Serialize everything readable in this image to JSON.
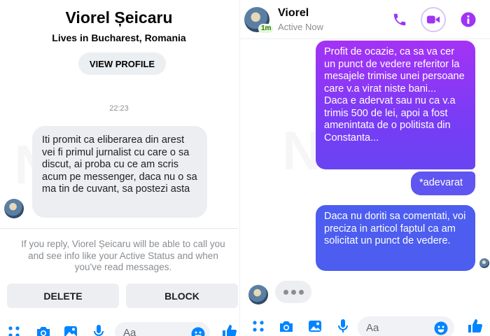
{
  "left": {
    "profile": {
      "name": "Viorel Șeicaru",
      "location": "Lives in Bucharest, Romania",
      "view_profile": "VIEW PROFILE"
    },
    "timestamp": "22:23",
    "message": "Iti promit ca eliberarea din arest vei fi primul jurnalist cu care o sa discut, ai proba cu ce am scris acum pe messenger, daca nu o sa ma tin de cuvant, sa postezi asta",
    "notice": "If you reply, Viorel Șeicaru will be able to call you and see info like your Active Status and when you've read messages.",
    "actions": {
      "delete": "DELETE",
      "block": "BLOCK"
    },
    "composer": {
      "placeholder": "Aa"
    }
  },
  "right": {
    "header": {
      "name": "Viorel",
      "status": "Active Now",
      "badge": "1m",
      "icons": [
        "phone-icon",
        "video-call-icon",
        "info-icon"
      ]
    },
    "messages": [
      {
        "sender": "me",
        "text": "Profit de ocazie, ca sa va cer un punct de vedere referitor la mesajele trimise unei persoane care v.a virat niste bani...\nDaca e adervat sau nu ca v.a trimis 500 de lei, apoi a fost amenintata de o politista din Constanta..."
      },
      {
        "sender": "me",
        "text": "*adevarat"
      },
      {
        "sender": "me",
        "text": "Daca nu doriti sa comentati, voi preciza in articol faptul ca am solicitat un punct de vedere."
      }
    ],
    "composer": {
      "placeholder": "Aa"
    }
  },
  "colors": {
    "accent": "#0084ff",
    "purple": "#a033f5",
    "blue_bubble": "#4c5df0",
    "received_bubble": "#eceef1"
  }
}
